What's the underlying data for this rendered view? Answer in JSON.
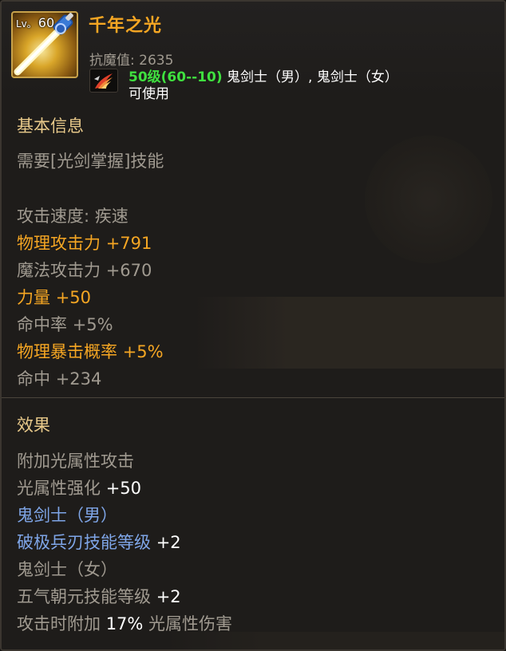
{
  "item": {
    "level_prefix": "Lv。",
    "level": "60",
    "name": "千年之光",
    "anti_magic": "抗魔值: 2635",
    "level_req": "50级(60--10)",
    "classes": " 鬼剑士（男）, 鬼剑士（女）",
    "usable": "可使用",
    "icon": "light-sword-icon",
    "class_icon": "ghost-swordsman-icon"
  },
  "basic": {
    "title": "基本信息",
    "skill_req": "需要[光剑掌握]技能",
    "attack_speed": "攻击速度: 疾速",
    "phys_atk_label": "物理攻击力 ",
    "phys_atk_val": "+791",
    "mag_atk_label": "魔法攻击力 ",
    "mag_atk_val": "+670",
    "str_label": "力量 ",
    "str_val": "+50",
    "hit_rate_label": "命中率 ",
    "hit_rate_val": "+5%",
    "crit_label": "物理暴击概率 ",
    "crit_val": "+5%",
    "hit_label": "命中 ",
    "hit_val": "+234"
  },
  "effects": {
    "title": "效果",
    "light_attack": "附加光属性攻击",
    "light_enh_label": "光属性强化 ",
    "light_enh_val": "+50",
    "class_male": "鬼剑士（男）",
    "skill_male_label": "破极兵刃技能等级 ",
    "skill_male_val": "+2",
    "class_female": "鬼剑士（女）",
    "skill_female_label": "五气朝元技能等级 ",
    "skill_female_val": "+2",
    "bonus_prefix": "攻击时附加 ",
    "bonus_val": "17%",
    "bonus_suffix": " 光属性伤害"
  },
  "colors": {
    "name": "#f5a623",
    "level_req": "#3fe03f",
    "label": "#a09a90",
    "highlight": "#f5a623",
    "class": "#7fa6e8",
    "section_title": "#e8c98a"
  }
}
